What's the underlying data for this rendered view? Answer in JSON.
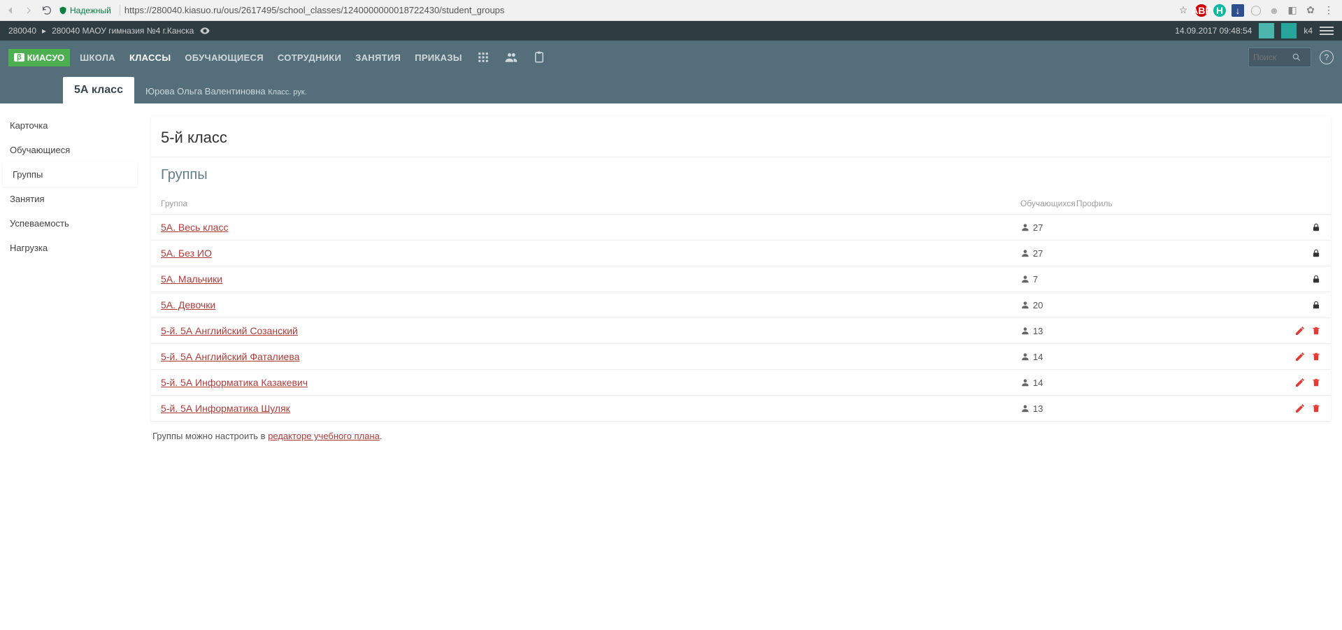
{
  "browser": {
    "secure_label": "Надежный",
    "url": "https://280040.kiasuo.ru/ous/2617495/school_classes/1240000000018722430/student_groups"
  },
  "context": {
    "code": "280040",
    "school": "280040 МАОУ гимназия №4 г.Канска",
    "timestamp": "14.09.2017 09:48:54",
    "user": "k4"
  },
  "logo": {
    "beta": "β",
    "brand": "КИАСУО"
  },
  "nav": {
    "items": [
      "ШКОЛА",
      "КЛАССЫ",
      "ОБУЧАЮЩИЕСЯ",
      "СОТРУДНИКИ",
      "ЗАНЯТИЯ",
      "ПРИКАЗЫ"
    ],
    "active_index": 1,
    "search_placeholder": "Поиск"
  },
  "class_header": {
    "class_name": "5А класс",
    "teacher": "Юрова Ольга Валентиновна",
    "teacher_role": "Класс. рук."
  },
  "sidebar": {
    "items": [
      "Карточка",
      "Обучающиеся",
      "Группы",
      "Занятия",
      "Успеваемость",
      "Нагрузка"
    ],
    "active_index": 2
  },
  "page": {
    "title": "5-й класс",
    "section": "Группы"
  },
  "table": {
    "headers": {
      "group": "Группа",
      "students": "Обучающихся",
      "profile": "Профиль"
    },
    "rows": [
      {
        "name": "5А. Весь класс",
        "count": 27,
        "locked": true
      },
      {
        "name": "5А. Без ИО",
        "count": 27,
        "locked": true
      },
      {
        "name": "5А. Мальчики",
        "count": 7,
        "locked": true
      },
      {
        "name": "5А. Девочки",
        "count": 20,
        "locked": true
      },
      {
        "name": "5-й. 5А Английский Созанский",
        "count": 13,
        "locked": false
      },
      {
        "name": "5-й. 5А Английский Фаталиева",
        "count": 14,
        "locked": false
      },
      {
        "name": "5-й. 5А Информатика Казакевич",
        "count": 14,
        "locked": false
      },
      {
        "name": "5-й. 5А Информатика Шуляк",
        "count": 13,
        "locked": false
      }
    ]
  },
  "footer": {
    "text": "Группы можно настроить в ",
    "link": "редакторе учебного плана",
    "period": "."
  }
}
